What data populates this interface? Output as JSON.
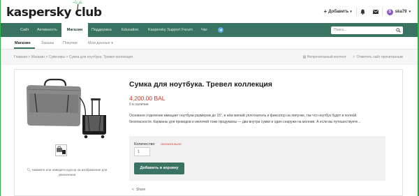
{
  "site": {
    "logo_text": "kaspersky club"
  },
  "header": {
    "add_label": "Добавить",
    "username": "ska79",
    "avatar_letter": "S"
  },
  "nav": {
    "items": [
      {
        "label": "Сайт"
      },
      {
        "label": "Активность"
      },
      {
        "label": "Магазин"
      },
      {
        "label": "Поддержка"
      },
      {
        "label": "Education"
      },
      {
        "label": "Kaspersky Support Forum"
      },
      {
        "label": "Чат"
      }
    ],
    "search_placeholder": "Поиск..."
  },
  "subnav": {
    "items": [
      {
        "label": "Магазин"
      },
      {
        "label": "Заказы"
      },
      {
        "label": "Покупки"
      },
      {
        "label": "Мои данные"
      }
    ]
  },
  "breadcrumb": {
    "text": "Главная  >  Магазин  >  Сувениры  >  Сумка для ноутбука. Тревел коллекция",
    "action_1": "Непрочитанный контент",
    "action_2": "Отметить сайт прочитанным"
  },
  "product": {
    "title": "Сумка для ноутбука. Тревел коллекция",
    "price": "4,200.00 BAL",
    "stock": "6 в наличии",
    "description_line1": "Основное отделение вмещает ноутбуки размером до 15\", в нём мягкий уплотнитель и фиксатор на липучке, так что ноутбук будет в полной",
    "description_line2": "безопасности. Карманы для проводов и мелочей тоже продуманы — два внутри сумки и один снаружи на молнии. А если вы путешествуете...",
    "image_hint": "Нажмите или наведите курсор на изображение для увеличения"
  },
  "buybox": {
    "quantity_label": "Количество",
    "required_label": "ОБЯЗАТЕЛЬНО",
    "quantity_value": "1",
    "buy_button": "Добавить в корзину"
  },
  "share_label": "Share",
  "colors": {
    "nav_bg": "#3b7363",
    "price": "#c0392b",
    "frame": "#2bb34a"
  }
}
